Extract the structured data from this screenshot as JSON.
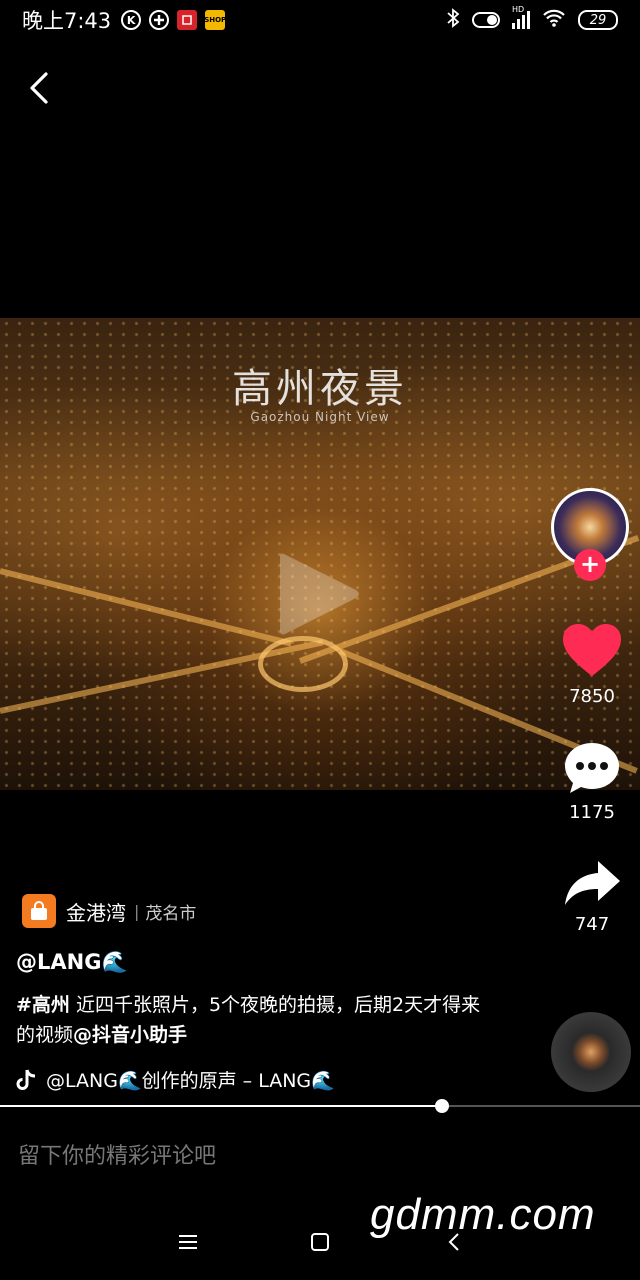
{
  "status_bar": {
    "time": "晚上7:43",
    "left_icons": [
      "k-icon",
      "plus-circle-icon",
      "app-red-icon",
      "shop-icon"
    ],
    "right_icons": [
      "bluetooth-icon",
      "toggle-icon",
      "signal-hd-icon",
      "wifi-icon"
    ],
    "battery": "29",
    "shop_icon_text": "SHOP",
    "k_icon_text": "K",
    "hd_text": "HD"
  },
  "video": {
    "title": "高州夜景",
    "subtitle": "Gaozhou Night View"
  },
  "actions": {
    "likes": "7850",
    "comments": "1175",
    "shares": "747",
    "follow_symbol": "+"
  },
  "location": {
    "name": "金港湾",
    "separator": "|",
    "city": "茂名市"
  },
  "post": {
    "username": "@LANG🌊",
    "hashtag": "#高州",
    "caption_text": " 近四千张照片，5个夜晚的拍摄，后期2天才得来的视频",
    "mention": "@抖音小助手"
  },
  "music": {
    "text": "@LANG🌊创作的原声 – LANG🌊"
  },
  "progress": {
    "fraction": 0.69
  },
  "comment": {
    "placeholder": "留下你的精彩评论吧"
  },
  "watermark": "gdmm.com",
  "colors": {
    "like": "#fe2c55",
    "follow": "#fe2c55",
    "location_icon": "#f47b20"
  }
}
